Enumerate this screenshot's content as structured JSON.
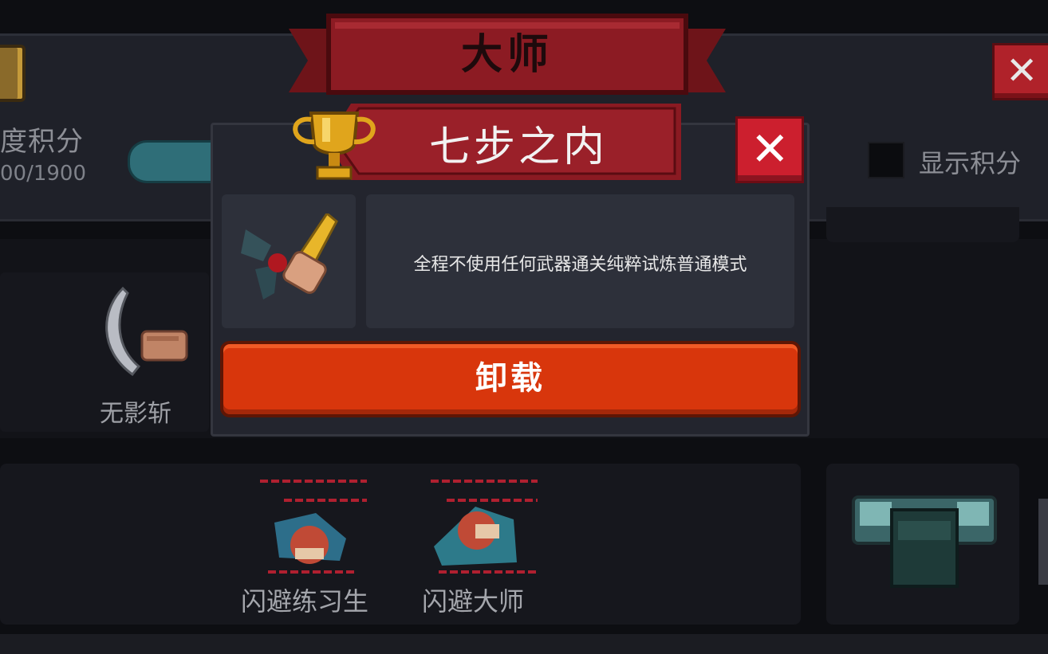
{
  "background": {
    "progress_label": "度积分",
    "progress_value": "00/1900",
    "show_score_label": "显示积分",
    "skill_left_label": "无影斩",
    "dodge_trainee_label": "闪避练习生",
    "dodge_master_label": "闪避大师"
  },
  "header": {
    "title": "大师"
  },
  "dialog": {
    "title": "七步之内",
    "description": "全程不使用任何武器通关纯粹试炼普通模式",
    "unequip_label": "卸载",
    "close_label": "✕"
  },
  "colors": {
    "banner_red": "#8c1b23",
    "button_orange": "#d8360c",
    "close_red": "#cc1f2e",
    "gold": "#e0a51c"
  },
  "icons": [
    "trophy-icon",
    "weapon-punch-icon",
    "scythe-icon",
    "dodge-trainee-icon",
    "dodge-master-icon",
    "chest-icon",
    "close-icon"
  ]
}
